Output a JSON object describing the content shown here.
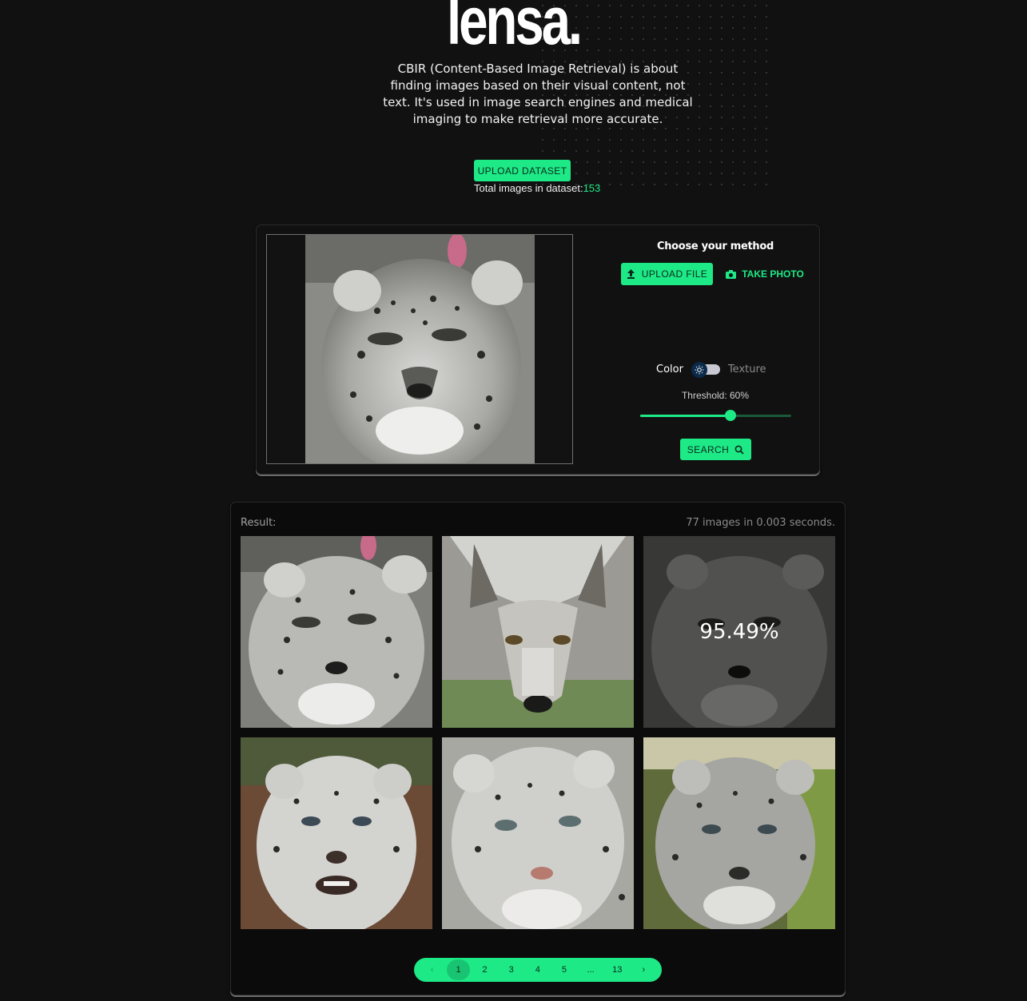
{
  "brand": {
    "logo": "lensa."
  },
  "intro": {
    "text": "CBIR (Content-Based Image Retrieval) is about finding images based on their visual content, not text. It's used in image search engines and medical imaging to make retrieval more accurate."
  },
  "dataset": {
    "upload_label": "UPLOAD DATASET",
    "total_label": "Total images in dataset:",
    "total_count": "153"
  },
  "query": {
    "method_title": "Choose your method",
    "upload_file_label": "UPLOAD FILE",
    "take_photo_label": "TAKE PHOTO",
    "mode_left": "Color",
    "mode_right": "Texture",
    "mode_selected": "Color",
    "threshold_label": "Threshold: 60%",
    "threshold_value": 0.6,
    "search_label": "SEARCH",
    "preview_image": "snow leopard face"
  },
  "result": {
    "label": "Result:",
    "stats": "77 images in 0.003 seconds.",
    "hover_score": "95.49%",
    "images": [
      "snow leopard (query match)",
      "grey wolf face",
      "snow leopard",
      "snow leopard snarling",
      "snow leopard face",
      "snow leopard in grass"
    ]
  },
  "pagination": {
    "prev": "‹",
    "pages": [
      "1",
      "2",
      "3",
      "4",
      "5",
      "...",
      "13"
    ],
    "next": "›",
    "current": "1"
  },
  "colors": {
    "accent": "#1de986",
    "background": "#111111",
    "card": "#0b0b0b"
  }
}
